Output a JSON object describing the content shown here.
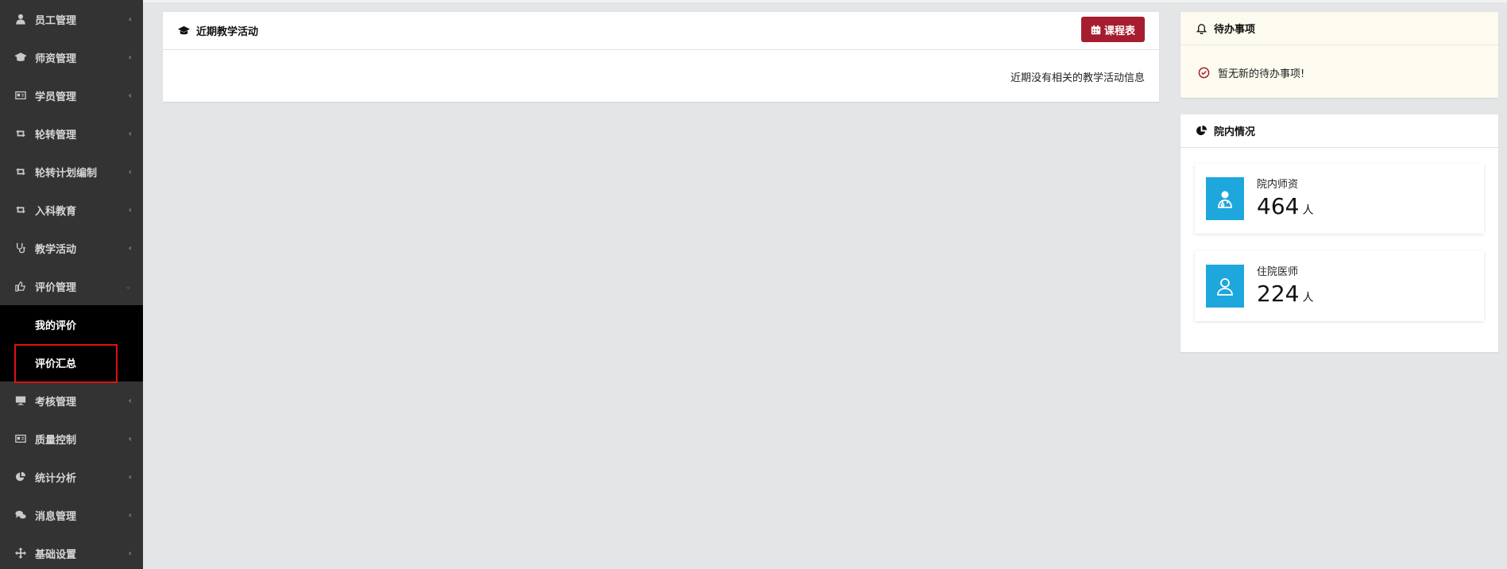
{
  "sidebar": {
    "items": [
      {
        "label": "员工管理",
        "icon": "user-icon"
      },
      {
        "label": "师资管理",
        "icon": "graduation-cap-icon"
      },
      {
        "label": "学员管理",
        "icon": "id-card-icon"
      },
      {
        "label": "轮转管理",
        "icon": "retweet-icon"
      },
      {
        "label": "轮转计划编制",
        "icon": "retweet-icon"
      },
      {
        "label": "入科教育",
        "icon": "retweet-icon"
      },
      {
        "label": "教学活动",
        "icon": "stethoscope-icon"
      },
      {
        "label": "评价管理",
        "icon": "thumbs-up-icon",
        "expanded": true
      },
      {
        "label": "考核管理",
        "icon": "monitor-icon"
      },
      {
        "label": "质量控制",
        "icon": "id-card-icon"
      },
      {
        "label": "统计分析",
        "icon": "pie-chart-icon"
      },
      {
        "label": "消息管理",
        "icon": "comments-icon"
      },
      {
        "label": "基础设置",
        "icon": "arrows-icon"
      }
    ],
    "submenu": [
      "我的评价",
      "评价汇总"
    ],
    "collapsed_chevron": "‹",
    "expanded_chevron": "⌄"
  },
  "activity": {
    "title": "近期教学活动",
    "schedule_button": "课程表",
    "empty_text": "近期没有相关的教学活动信息"
  },
  "todo": {
    "title": "待办事项",
    "message": "暂无新的待办事项!"
  },
  "hospital": {
    "title": "院内情况",
    "teachers_label": "院内师资",
    "teachers_count": "464",
    "teachers_unit": "人",
    "residents_label": "住院医师",
    "residents_count": "224",
    "residents_unit": "人"
  },
  "colors": {
    "sidebar_bg": "#333333",
    "submenu_bg": "#000000",
    "accent_red": "#a61d2f",
    "stat_blue": "#1ea7dc",
    "todo_bg": "#fdfbef"
  }
}
